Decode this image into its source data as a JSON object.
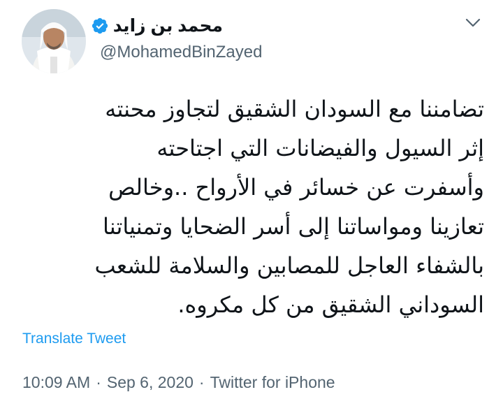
{
  "header": {
    "display_name": "محمد بن زايد",
    "handle": "@MohamedBinZayed",
    "icons": {
      "verified": "verified-badge-icon",
      "menu": "chevron-down-icon"
    },
    "colors": {
      "verified": "#1d9bf0",
      "translate_link": "#1d9bf0",
      "muted": "#536471"
    }
  },
  "tweet": {
    "lines": [
      "تضامننا مع السودان الشقيق لتجاوز محنته",
      "إثر السيول والفيضانات التي اجتاحته",
      "وأسفرت عن خسائر في الأرواح ..وخالص",
      "تعازينا ومواساتنا إلى أسر الضحايا وتمنياتنا",
      "بالشفاء العاجل للمصابين والسلامة للشعب",
      "السوداني الشقيق من كل مكروه."
    ],
    "translate_label": "Translate Tweet"
  },
  "meta": {
    "time": "10:09 AM",
    "separator": "·",
    "date": "Sep 6, 2020",
    "source": "Twitter for iPhone"
  }
}
